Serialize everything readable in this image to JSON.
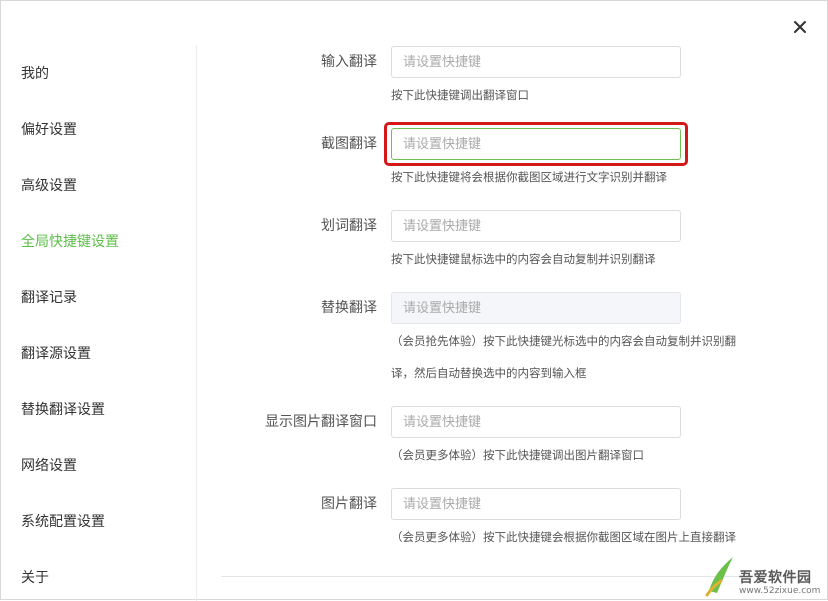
{
  "close_icon": "close-icon",
  "sidebar": {
    "active": "全局快捷键设置",
    "items": [
      {
        "label": "我的"
      },
      {
        "label": "偏好设置"
      },
      {
        "label": "高级设置"
      },
      {
        "label": "全局快捷键设置"
      },
      {
        "label": "翻译记录"
      },
      {
        "label": "翻译源设置"
      },
      {
        "label": "替换翻译设置"
      },
      {
        "label": "网络设置"
      },
      {
        "label": "系统配置设置"
      },
      {
        "label": "关于"
      }
    ]
  },
  "hotkeys": [
    {
      "label": "输入翻译",
      "placeholder": "请设置快捷键",
      "value": "",
      "desc": [
        "按下此快捷键调出翻译窗口"
      ]
    },
    {
      "label": "截图翻译",
      "placeholder": "请设置快捷键",
      "value": "",
      "desc": [
        "按下此快捷键将会根据你截图区域进行文字识别并翻译"
      ]
    },
    {
      "label": "划词翻译",
      "placeholder": "请设置快捷键",
      "value": "",
      "desc": [
        "按下此快捷键鼠标选中的内容会自动复制并识别翻译"
      ]
    },
    {
      "label": "替换翻译",
      "placeholder": "请设置快捷键",
      "value": "",
      "desc": [
        "（会员抢先体验）按下此快捷键光标选中的内容会自动复制并识别翻",
        "译，然后自动替换选中的内容到输入框"
      ]
    },
    {
      "label": "显示图片翻译窗口",
      "placeholder": "请设置快捷键",
      "value": "",
      "desc": [
        "（会员更多体验）按下此快捷键调出图片翻译窗口"
      ]
    },
    {
      "label": "图片翻译",
      "placeholder": "请设置快捷键",
      "value": "",
      "desc": [
        "（会员更多体验）按下此快捷键会根据你截图区域在图片上直接翻译"
      ]
    }
  ],
  "focused_field": "截图翻译",
  "accent_color": "#5dbf4a",
  "highlight_color": "#d41717",
  "watermark": {
    "brand": "吾爱软件园",
    "url": "www.52zixue.com"
  }
}
